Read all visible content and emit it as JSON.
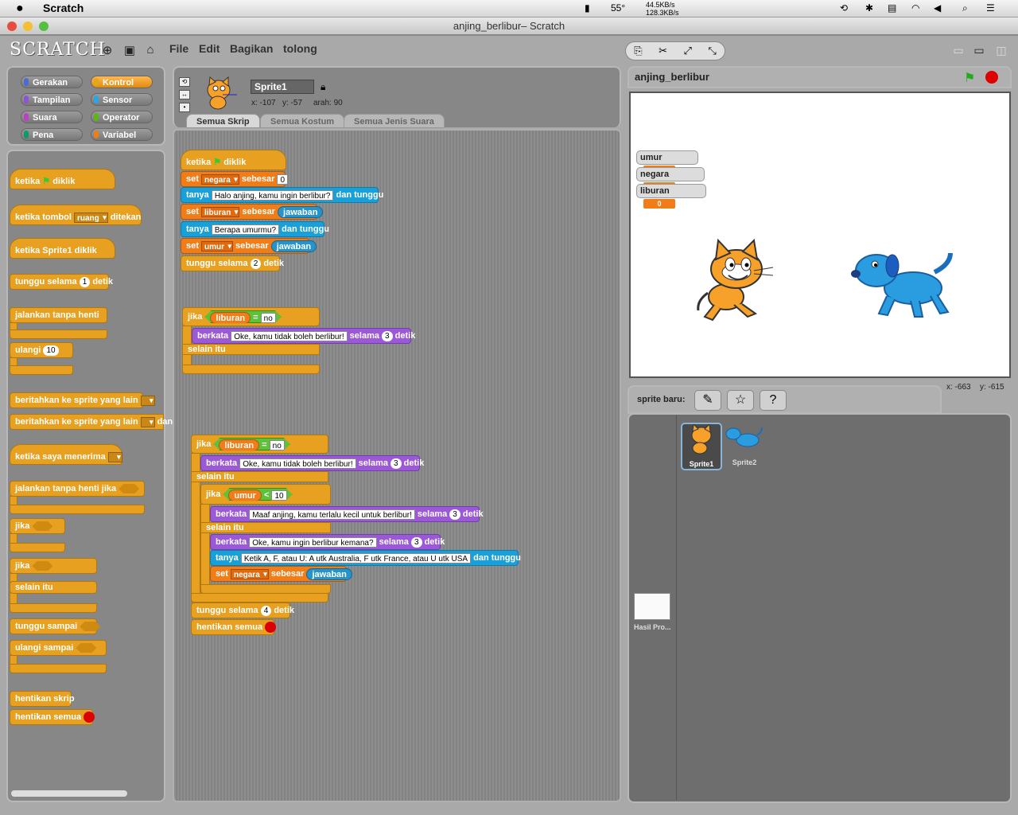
{
  "macbar": {
    "apple": "",
    "app": "Scratch",
    "temp": "55°",
    "net_up": "44.5KB/s",
    "net_down": "128.3KB/s"
  },
  "window": {
    "title": "anjing_berlibur– Scratch"
  },
  "toolbar": {
    "logo": "SCRATCH",
    "menus": [
      "File",
      "Edit",
      "Bagikan",
      "tolong"
    ]
  },
  "categories": [
    {
      "label": "Gerakan",
      "color": "#4a6cd4"
    },
    {
      "label": "Kontrol",
      "color": "#e1a91a"
    },
    {
      "label": "Tampilan",
      "color": "#8a55d7"
    },
    {
      "label": "Sensor",
      "color": "#2ca5e2"
    },
    {
      "label": "Suara",
      "color": "#bb42c3"
    },
    {
      "label": "Operator",
      "color": "#5cb712"
    },
    {
      "label": "Pena",
      "color": "#0e9a6c"
    },
    {
      "label": "Variabel",
      "color": "#ee7d16"
    }
  ],
  "palette": {
    "when_flag": "ketika",
    "clicked": "diklik",
    "when_key": "ketika tombol",
    "key_val": "ruang",
    "pressed": "ditekan",
    "when_sprite": "ketika",
    "sprite_name": "Sprite1",
    "wait": "tunggu selama",
    "wait_val": "1",
    "secs": "detik",
    "forever": "jalankan tanpa henti",
    "repeat": "ulangi",
    "repeat_val": "10",
    "broadcast": "beritahkan ke sprite yang lain",
    "broadcast_wait": "beritahkan ke sprite yang lain",
    "and_wait": "dan t",
    "when_receive": "ketika saya menerima",
    "forever_if": "jalankan tanpa henti jika",
    "if": "jika",
    "if2": "jika",
    "else": "selain itu",
    "wait_until": "tunggu sampai",
    "repeat_until": "ulangi sampai",
    "stop_script": "hentikan skrip",
    "stop_all": "hentikan semua"
  },
  "sprite_info": {
    "name": "Sprite1",
    "x": "x: -107",
    "y": "y: -57",
    "dir": "arah: 90"
  },
  "tabs": [
    "Semua Skrip",
    "Semua Kostum",
    "Semua Jenis Suara"
  ],
  "script": {
    "hat_when": "ketika",
    "hat_clicked": "diklik",
    "b1_set": "set",
    "b1_var": "negara",
    "b1_to": "sebesar",
    "b1_val": "0",
    "b2_ask": "tanya",
    "b2_text": "Halo anjing, kamu ingin berlibur?",
    "b2_wait": "dan tunggu",
    "b3_set": "set",
    "b3_var": "liburan",
    "b3_to": "sebesar",
    "b3_ans": "jawaban",
    "b4_ask": "tanya",
    "b4_text": "Berapa umurmu?",
    "b4_wait": "dan tunggu",
    "b5_set": "set",
    "b5_var": "umur",
    "b5_to": "sebesar",
    "b5_ans": "jawaban",
    "b6_wait": "tunggu selama",
    "b6_val": "2",
    "b6_secs": "detik",
    "if1": "jika",
    "if1_var": "liburan",
    "if1_op": "=",
    "if1_val": "no",
    "if1_say": "berkata",
    "if1_text": "Oke, kamu tidak boleh berlibur!",
    "if1_for": "selama",
    "if1_n": "3",
    "if1_secs": "detik",
    "if1_else": "selain itu",
    "if2": "jika",
    "if2_var": "liburan",
    "if2_op": "=",
    "if2_val": "no",
    "if2_say": "berkata",
    "if2_text": "Oke, kamu tidak boleh berlibur!",
    "if2_for": "selama",
    "if2_n": "3",
    "if2_secs": "detik",
    "if2_else": "selain itu",
    "if3": "jika",
    "if3_var": "umur",
    "if3_op": "<",
    "if3_val": "10",
    "if3_say": "berkata",
    "if3_text": "Maaf anjing, kamu terlalu kecil untuk berlibur!",
    "if3_for": "selama",
    "if3_n": "3",
    "if3_secs": "detik",
    "if3_else": "selain itu",
    "e3_say": "berkata",
    "e3_text": "Oke, kamu ingin berlibur kemana?",
    "e3_for": "selama",
    "e3_n": "3",
    "e3_secs": "detik",
    "e3_ask": "tanya",
    "e3_asktext": "Ketik A, F, atau U:  A utk Australia, F utk France, atau U utk USA",
    "e3_wait": "dan tunggu",
    "e3_set": "set",
    "e3_var": "negara",
    "e3_to": "sebesar",
    "e3_ans": "jawaban",
    "w4": "tunggu selama",
    "w4_val": "4",
    "w4_secs": "detik",
    "stop": "hentikan semua"
  },
  "stage": {
    "title": "anjing_berlibur",
    "monitors": [
      {
        "label": "umur",
        "value": "0"
      },
      {
        "label": "negara",
        "value": "0"
      },
      {
        "label": "liburan",
        "value": "0"
      }
    ],
    "mouse_x": "x: -663",
    "mouse_y": "y: -615"
  },
  "sprites": {
    "new_label": "sprite baru:",
    "list": [
      "Sprite1",
      "Sprite2"
    ],
    "stage_label": "Hasil Pro..."
  }
}
